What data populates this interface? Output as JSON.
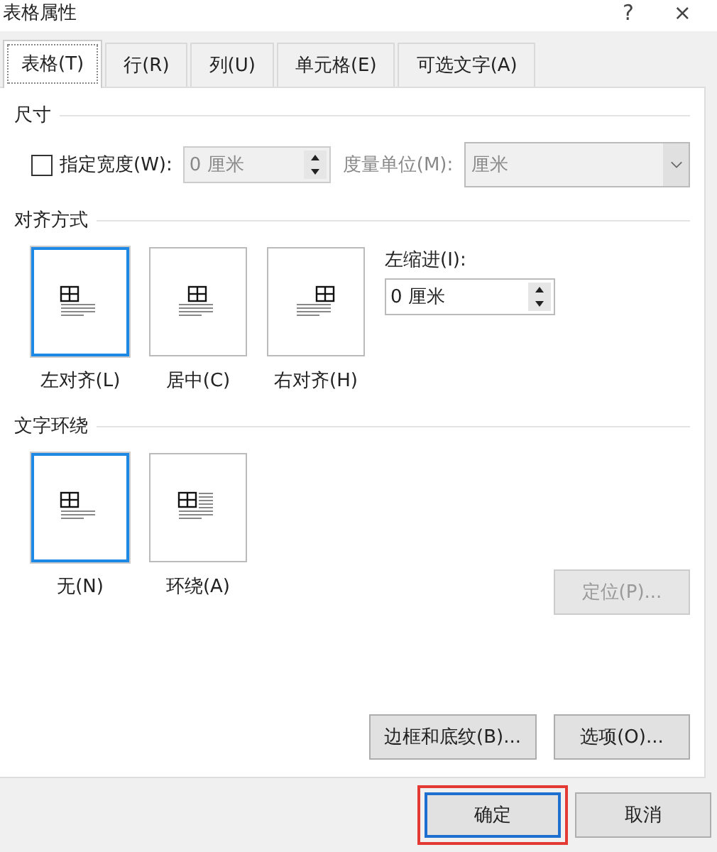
{
  "window": {
    "title": "表格属性",
    "help": "?",
    "close": "×"
  },
  "tabs": [
    {
      "label": "表格(T)",
      "selected": true
    },
    {
      "label": "行(R)",
      "selected": false
    },
    {
      "label": "列(U)",
      "selected": false
    },
    {
      "label": "单元格(E)",
      "selected": false
    },
    {
      "label": "可选文字(A)",
      "selected": false
    }
  ],
  "size": {
    "heading": "尺寸",
    "width_checkbox": {
      "label": "指定宽度(W):",
      "checked": false
    },
    "width_field": {
      "value": "0 厘米",
      "disabled": true
    },
    "unit_label": "度量单位(M):",
    "unit_dropdown": {
      "value": "厘米",
      "disabled": true
    }
  },
  "alignment": {
    "heading": "对齐方式",
    "options": [
      {
        "label": "左对齐(L)",
        "kind": "left",
        "selected": true
      },
      {
        "label": "居中(C)",
        "kind": "center",
        "selected": false
      },
      {
        "label": "右对齐(H)",
        "kind": "right",
        "selected": false
      }
    ],
    "indent_label": "左缩进(I):",
    "indent_field": {
      "value": "0 厘米"
    }
  },
  "wrapping": {
    "heading": "文字环绕",
    "options": [
      {
        "label": "无(N)",
        "kind": "none",
        "selected": true
      },
      {
        "label": "环绕(A)",
        "kind": "around",
        "selected": false
      }
    ],
    "position_button": {
      "label": "定位(P)...",
      "disabled": true
    }
  },
  "panel_buttons": [
    "边框和底纹(B)...",
    "选项(O)..."
  ],
  "dialog_buttons": [
    {
      "label": "确定",
      "default": true
    },
    {
      "label": "取消",
      "default": false
    }
  ]
}
